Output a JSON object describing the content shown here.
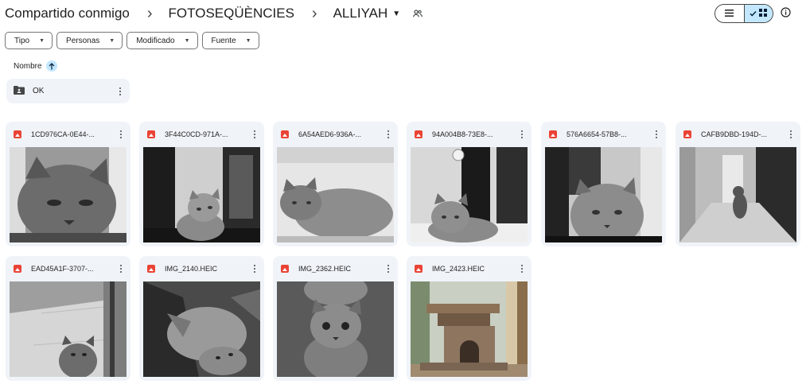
{
  "breadcrumb": {
    "root": "Compartido conmigo",
    "middle": "FOTOSEQÜÈNCIES",
    "current": "ALLIYAH"
  },
  "filters": [
    "Tipo",
    "Personas",
    "Modificado",
    "Fuente"
  ],
  "sort": {
    "label": "Nombre",
    "direction": "ascending"
  },
  "folders": [
    {
      "name": "OK"
    }
  ],
  "files": [
    {
      "name": "1CD976CA-0E44-..."
    },
    {
      "name": "3F44C0CD-971A-..."
    },
    {
      "name": "6A54AED6-936A-..."
    },
    {
      "name": "94A004B8-73E8-..."
    },
    {
      "name": "576A6654-57B8-..."
    },
    {
      "name": "CAFB9DBD-194D-..."
    },
    {
      "name": "EAD45A1F-3707-..."
    },
    {
      "name": "IMG_2140.HEIC"
    },
    {
      "name": "IMG_2362.HEIC"
    },
    {
      "name": "IMG_2423.HEIC"
    }
  ],
  "view": {
    "mode": "grid"
  },
  "colors": {
    "accent": "#c2e7ff",
    "card_bg": "#f0f4f9",
    "image_icon": "#ea4335",
    "text": "#1f1f1f"
  },
  "icons": {
    "separator": "chevron-right-icon",
    "dropdown": "caret-down-icon",
    "shared": "people-icon",
    "list_view": "list-icon",
    "grid_view": "grid-icon",
    "info": "info-icon",
    "sort": "arrow-up-icon",
    "folder": "shared-folder-icon",
    "file": "image-file-icon",
    "more": "more-vert-icon"
  }
}
